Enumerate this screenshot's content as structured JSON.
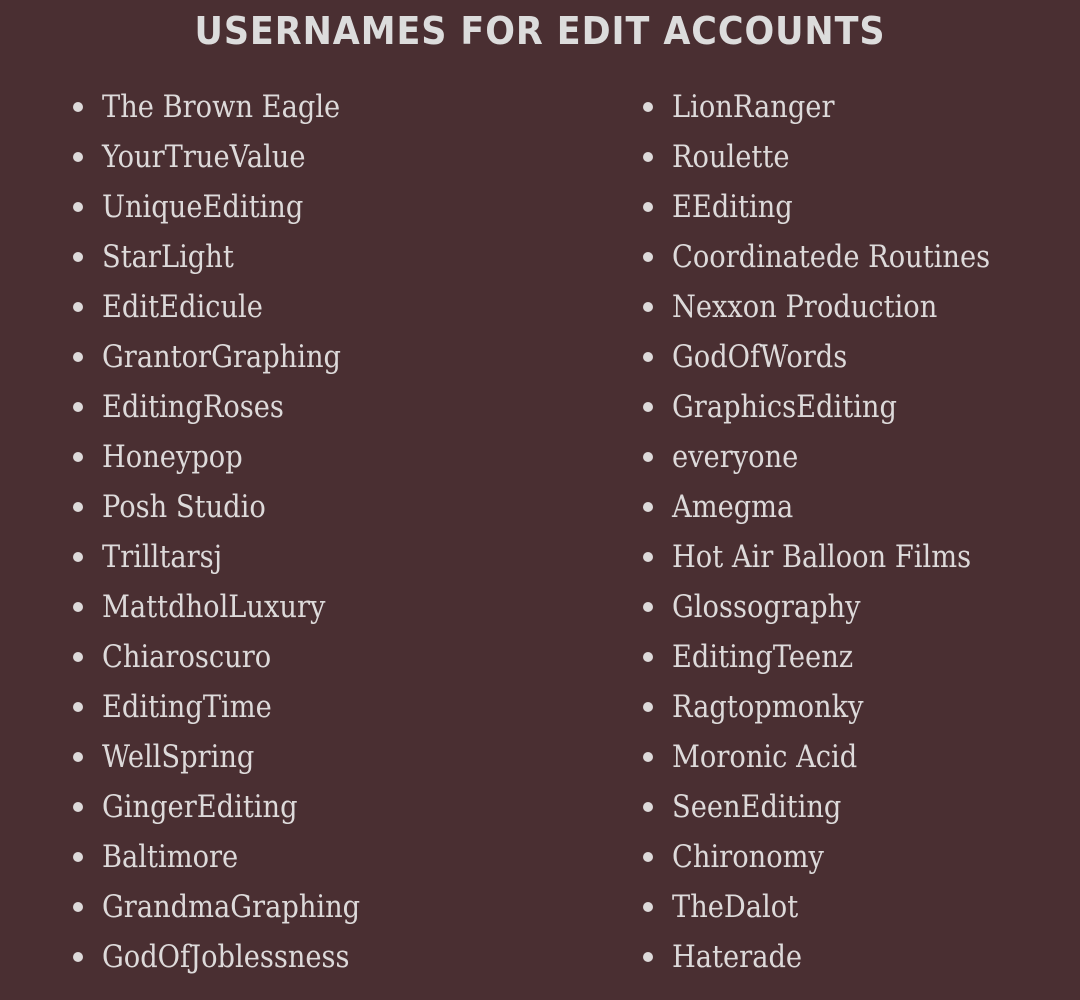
{
  "title": "Usernames For Edit Accounts",
  "colors": {
    "background": "#4a2f32",
    "text": "#dddada"
  },
  "list": {
    "left": [
      "The Brown Eagle",
      "YourTrueValue",
      "UniqueEditing",
      "StarLight",
      "EditEdicule",
      "GrantorGraphing",
      "EditingRoses",
      "Honeypop",
      "Posh Studio",
      "Trilltarsj",
      "MattdholLuxury",
      "Chiaroscuro",
      "EditingTime",
      "WellSpring",
      "GingerEditing",
      "Baltimore",
      "GrandmaGraphing",
      "GodOfJoblessness"
    ],
    "right": [
      "LionRanger",
      "Roulette",
      "EEditing",
      "Coordinatede Routines",
      "Nexxon Production",
      "GodOfWords",
      "GraphicsEditing",
      "everyone",
      "Amegma",
      "Hot Air Balloon Films",
      "Glossography",
      "EditingTeenz",
      "Ragtopmonky",
      "Moronic Acid",
      "SeenEditing",
      "Chironomy",
      "TheDalot",
      "Haterade"
    ]
  }
}
